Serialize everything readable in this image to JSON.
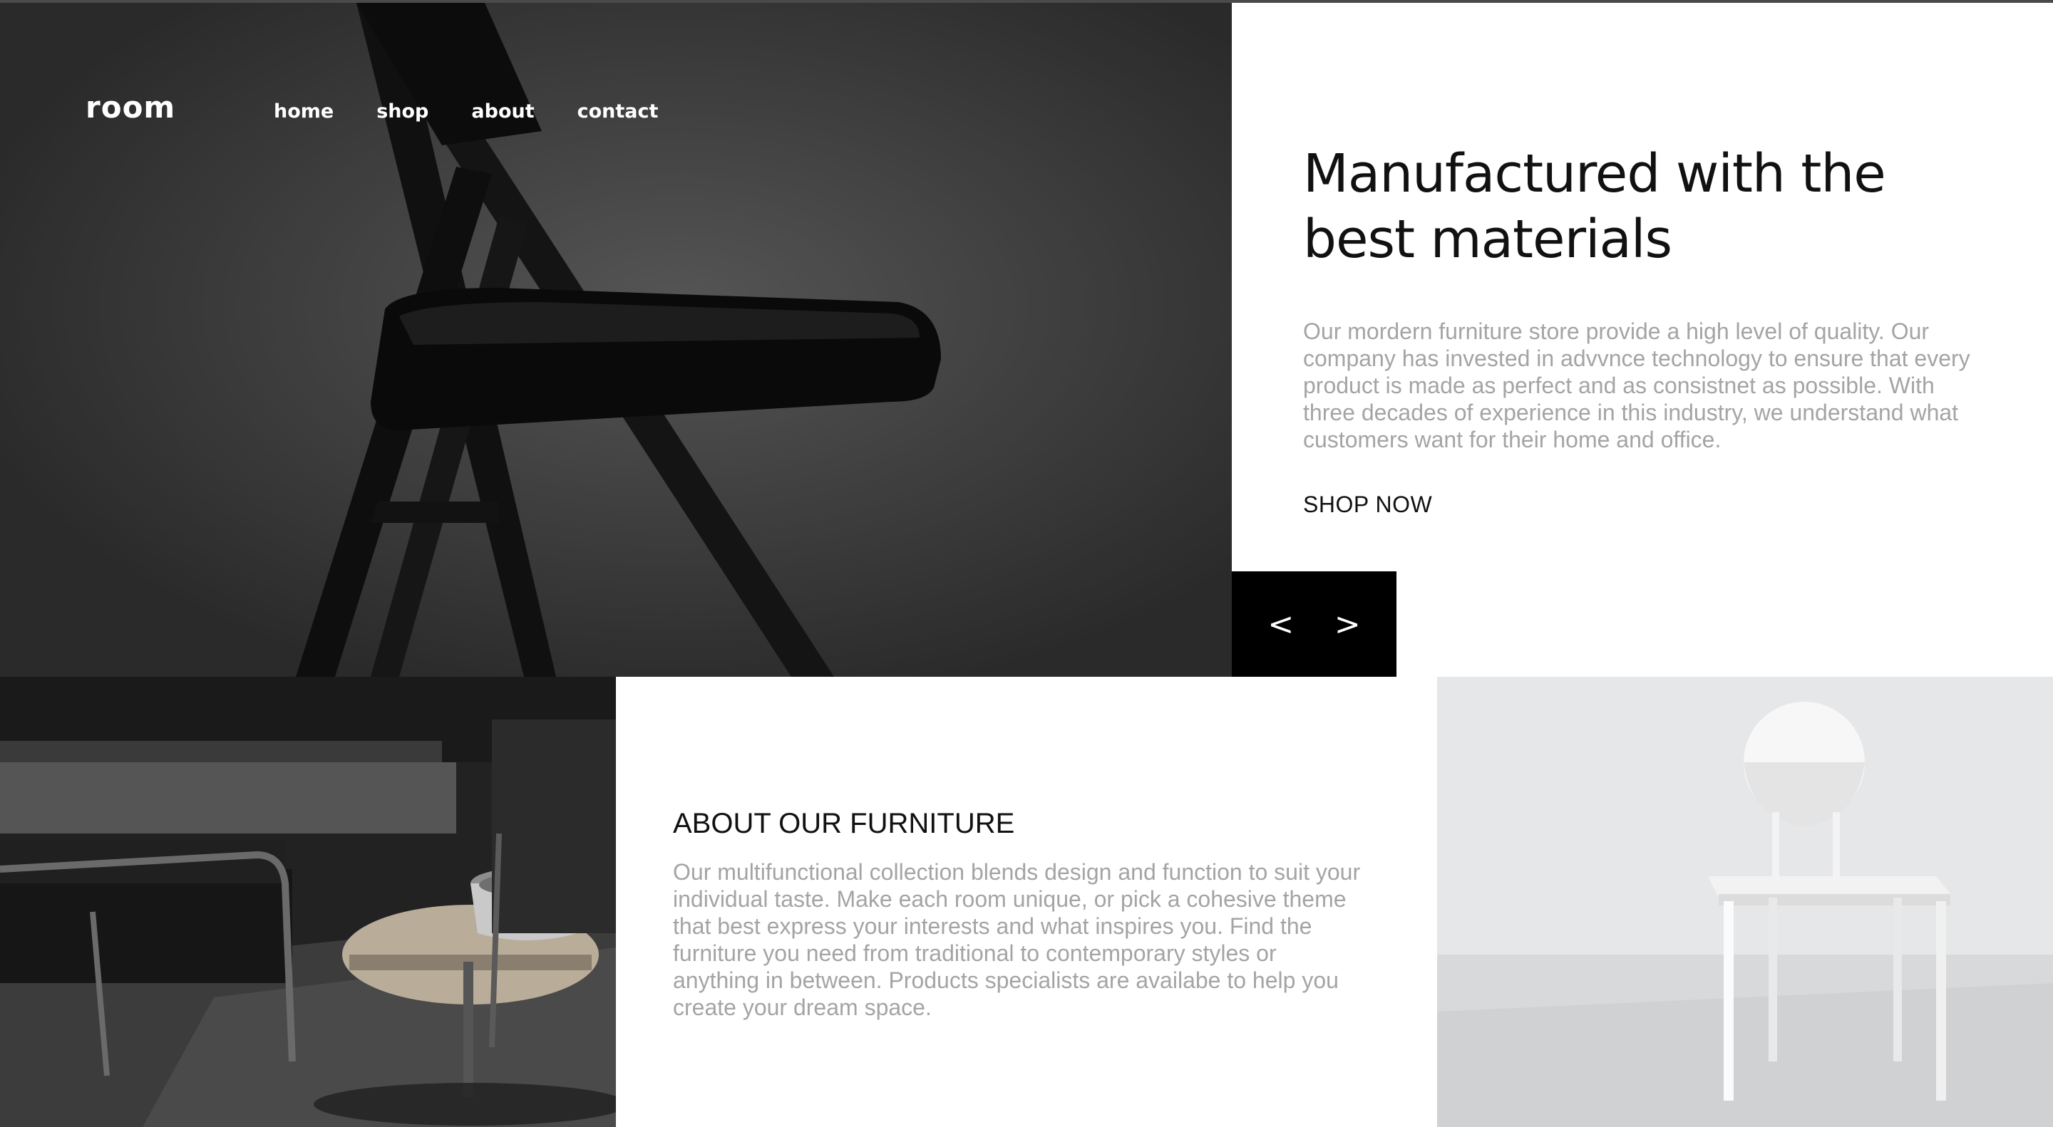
{
  "brand": {
    "name": "room"
  },
  "nav": {
    "items": [
      "home",
      "shop",
      "about",
      "contact"
    ]
  },
  "hero": {
    "title": "Manufactured with the best materials",
    "description": "Our mordern furniture store provide a high level of quality. Our company has invested in advvnce technology to ensure that every product is made as perfect and as consistnet as possible. With three decades of experience in this industry, we understand what customers want for their home and office.",
    "cta": "SHOP NOW"
  },
  "slider": {
    "prev": "<",
    "next": ">"
  },
  "about": {
    "title": "ABOUT OUR FURNITURE",
    "description": "Our multifunctional collection blends design and function to suit your individual taste. Make each room unique, or pick a cohesive theme that best express your interests and what inspires you. Find the furniture you need from traditional to contemporary styles or anything in between. Products specialists are availabe to help you create your dream space."
  },
  "images": {
    "hero": "black-folding-chair-photo",
    "room": "dark-living-room-photo",
    "chair": "white-chair-photo"
  },
  "colors": {
    "text_dark": "#111111",
    "text_muted": "#a4a4a4",
    "slider_bg": "#000000",
    "hero_bg": "#3a3a3a"
  }
}
